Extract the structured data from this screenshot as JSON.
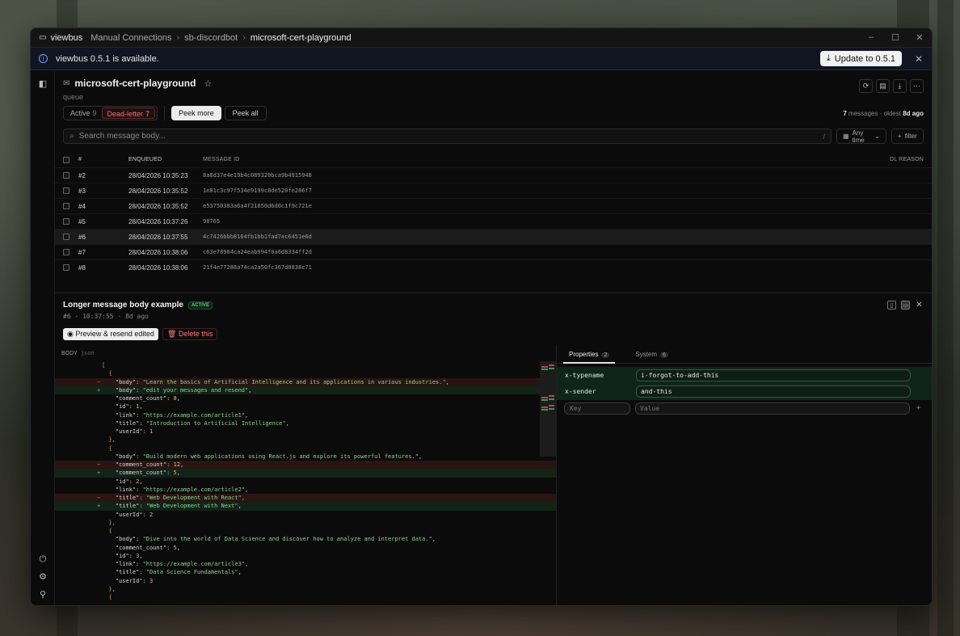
{
  "app": {
    "name": "viewbus"
  },
  "breadcrumb": [
    "Manual Connections",
    "sb-discordbot",
    "microsoft-cert-playground"
  ],
  "window_controls": {
    "minimize": "–",
    "maximize": "☐",
    "close": "✕"
  },
  "banner": {
    "text": "viewbus 0.5.1 is available.",
    "button": "Update to 0.5.1"
  },
  "queue": {
    "name": "microsoft-cert-playground",
    "type": "queue"
  },
  "tabs": {
    "active_label": "Active",
    "active_count": "9",
    "dl_label": "Dead-letter",
    "dl_count": "7"
  },
  "peek": {
    "more": "Peek more",
    "all": "Peek all"
  },
  "stats": {
    "count": "7",
    "messages_label": "messages",
    "oldest_label": "oldest",
    "oldest_value": "8d ago"
  },
  "search": {
    "placeholder": "Search message body...",
    "shortcut": "/"
  },
  "filters": {
    "time": "Any time",
    "add": "filter"
  },
  "table": {
    "headers": {
      "num": "#",
      "enqueued": "ENQUEUED",
      "message_id": "MESSAGE ID",
      "dl_reason": "DL REASON"
    },
    "rows": [
      {
        "num": "#2",
        "enqueued": "28/04/2026 10:35:23",
        "id": "8a8d37e4e19b4c089320bca9b4915948"
      },
      {
        "num": "#3",
        "enqueued": "28/04/2026 10:35:52",
        "id": "1e81c3c97f534e9199c8de520fe286f7"
      },
      {
        "num": "#4",
        "enqueued": "28/04/2026 10:35:52",
        "id": "e53750383a6a4f21850d6d0c1f9c721e"
      },
      {
        "num": "#5",
        "enqueued": "28/04/2026 10:37:26",
        "id": "98765"
      },
      {
        "num": "#6",
        "enqueued": "28/04/2026 10:37:55",
        "id": "4c7426bbb8164fb1bb1fad7ac6451e6d"
      },
      {
        "num": "#7",
        "enqueued": "28/04/2026 10:38:06",
        "id": "c63e78904ca24eab994f0a6d8334ff2d"
      },
      {
        "num": "#8",
        "enqueued": "28/04/2026 10:38:06",
        "id": "21f4e77288a74ca2a50fc367d8838c71"
      }
    ]
  },
  "detail": {
    "title": "Longer message body example",
    "status": "ACTIVE",
    "seq": "#6",
    "time": "10:37:55",
    "age": "8d ago",
    "preview_btn": "Preview & resend edited",
    "delete_btn": "Delete this",
    "body_label": "BODY",
    "body_format": "json"
  },
  "props": {
    "tab_properties": "Properties",
    "tab_properties_count": "2",
    "tab_system": "System",
    "tab_system_count": "6",
    "items": [
      {
        "key": "x-typename",
        "value": "i-forgot-to-add-this"
      },
      {
        "key": "x-sender",
        "value": "and-this"
      }
    ],
    "key_placeholder": "Key",
    "value_placeholder": "Value"
  },
  "code_lines": [
    {
      "t": "n",
      "text": "["
    },
    {
      "t": "n",
      "text": "  {"
    },
    {
      "t": "d",
      "text": "    \"body\": \"Learn the basics of Artificial Intelligence and its applications in various industries.\","
    },
    {
      "t": "a",
      "text": "    \"body\": \"edit your messages and resend\","
    },
    {
      "t": "n",
      "text": "    \"comment_count\": 8,"
    },
    {
      "t": "n",
      "text": "    \"id\": 1,"
    },
    {
      "t": "n",
      "text": "    \"link\": \"https://example.com/article1\","
    },
    {
      "t": "n",
      "text": "    \"title\": \"Introduction to Artificial Intelligence\","
    },
    {
      "t": "n",
      "text": "    \"userId\": 1"
    },
    {
      "t": "n",
      "text": "  },"
    },
    {
      "t": "n",
      "text": "  {"
    },
    {
      "t": "n",
      "text": "    \"body\": \"Build modern web applications using React.js and explore its powerful features.\","
    },
    {
      "t": "d",
      "text": "    \"comment_count\": 12,"
    },
    {
      "t": "a",
      "text": "    \"comment_count\": 5,"
    },
    {
      "t": "n",
      "text": "    \"id\": 2,"
    },
    {
      "t": "n",
      "text": "    \"link\": \"https://example.com/article2\","
    },
    {
      "t": "d",
      "text": "    \"title\": \"Web Development with React\","
    },
    {
      "t": "a",
      "text": "    \"title\": \"Web Development with Next\","
    },
    {
      "t": "n",
      "text": "    \"userId\": 2"
    },
    {
      "t": "n",
      "text": "  },"
    },
    {
      "t": "n",
      "text": "  {"
    },
    {
      "t": "n",
      "text": "    \"body\": \"Dive into the world of Data Science and discover how to analyze and interpret data.\","
    },
    {
      "t": "n",
      "text": "    \"comment_count\": 5,"
    },
    {
      "t": "n",
      "text": "    \"id\": 3,"
    },
    {
      "t": "n",
      "text": "    \"link\": \"https://example.com/article3\","
    },
    {
      "t": "n",
      "text": "    \"title\": \"Data Science Fundamentals\","
    },
    {
      "t": "n",
      "text": "    \"userId\": 3"
    },
    {
      "t": "n",
      "text": "  },"
    },
    {
      "t": "n",
      "text": "  {"
    }
  ]
}
